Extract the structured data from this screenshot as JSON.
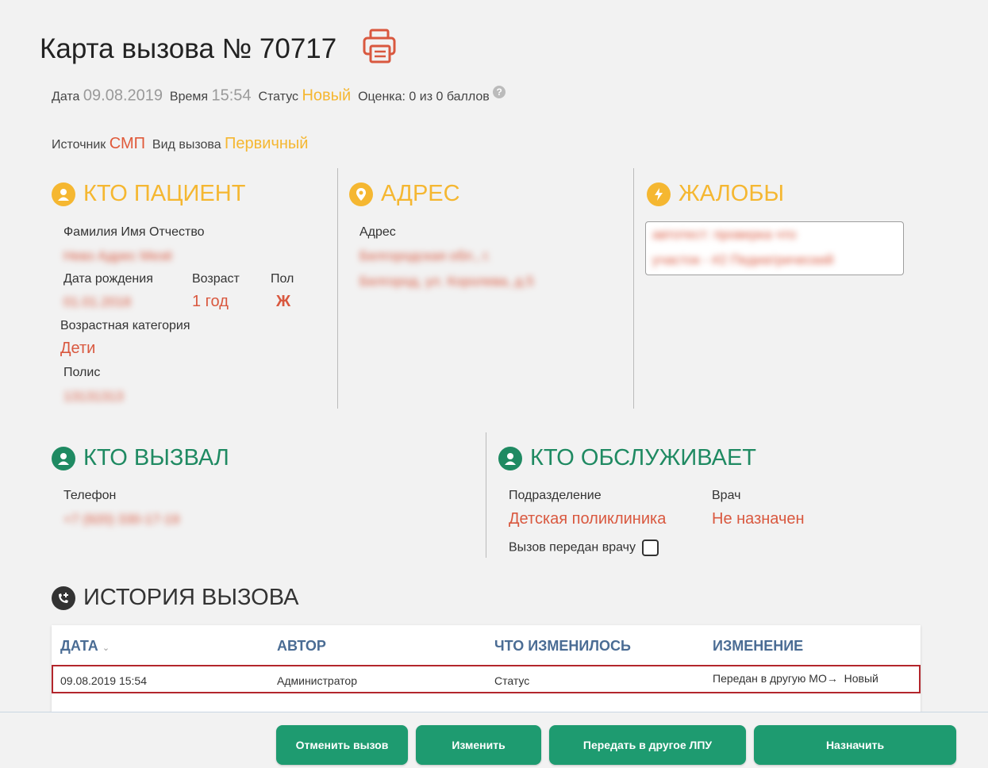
{
  "card": {
    "title": "Карта вызова № 70717",
    "date_label": "Дата",
    "date": "09.08.2019",
    "time_label": "Время",
    "time": "15:54",
    "status_label": "Статус",
    "status": "Новый",
    "score": "Оценка: 0 из 0 баллов",
    "source_label": "Источник",
    "source": "СМП",
    "call_type_label": "Вид вызова",
    "call_type": "Первичный"
  },
  "patient": {
    "title": "КТО ПАЦИЕНТ",
    "fio_label": "Фамилия Имя Отчество",
    "fio": "Невз Адрес Мезё",
    "dob_label": "Дата рождения",
    "dob": "01.01.2018",
    "age_label": "Возраст",
    "age": "1 год",
    "sex_label": "Пол",
    "sex": "Ж",
    "age_cat_label": "Возрастная категория",
    "age_cat": "Дети",
    "policy_label": "Полис",
    "policy": "13131313"
  },
  "address": {
    "title": "АДРЕС",
    "label": "Адрес",
    "line1": "Белгородская обл., г.",
    "line2": "Белгород, ул. Королева, д.5"
  },
  "complaints": {
    "title": "ЖАЛОБЫ",
    "line1": "автотест: проверка что",
    "line2": "участок - #2 Педиатрический"
  },
  "caller": {
    "title": "КТО ВЫЗВАЛ",
    "phone_label": "Телефон",
    "phone": "+7 (920) 330-17-19"
  },
  "service": {
    "title": "КТО ОБСЛУЖИВАЕТ",
    "division_label": "Подразделение",
    "division": "Детская поликлиника",
    "doctor_label": "Врач",
    "doctor": "Не назначен",
    "transferred_label": "Вызов передан врачу"
  },
  "history": {
    "title": "ИСТОРИЯ ВЫЗОВА",
    "columns": [
      "ДАТА",
      "АВТОР",
      "ЧТО ИЗМЕНИЛОСЬ",
      "ИЗМЕНЕНИЕ"
    ],
    "rows": [
      {
        "date": "09.08.2019 15:54",
        "author": "Администратор",
        "what": "Статус",
        "from": "Передан в другую МО",
        "to": "Новый"
      }
    ]
  },
  "buttons": {
    "cancel": "Отменить вызов",
    "edit": "Изменить",
    "transfer": "Передать в другое ЛПУ",
    "assign": "Назначить"
  },
  "colors": {
    "accent_orange": "#f5b731",
    "value_red": "#d9583f",
    "green": "#1e9b70",
    "table_header": "#4a6c94"
  }
}
